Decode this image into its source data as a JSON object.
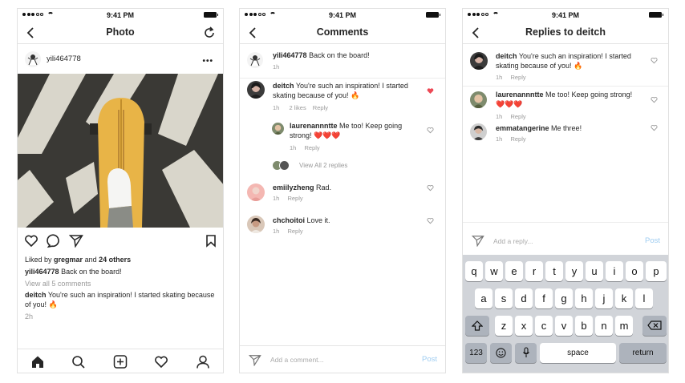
{
  "status": {
    "time": "9:41 PM"
  },
  "screen1": {
    "title": "Photo",
    "username": "yili464778",
    "liked_prefix": "Liked by",
    "liked_user": "gregmar",
    "liked_and": "and",
    "liked_count": "24 others",
    "caption_user": "yili464778",
    "caption_text": "Back on the board!",
    "view_all": "View all 5 comments",
    "comment_user": "deitch",
    "comment_text": "You're such an inspiration! I started skating because of you! 🔥",
    "time_ago": "2h",
    "tabs": [
      "home-icon",
      "search-icon",
      "add-icon",
      "heart-icon",
      "profile-icon"
    ]
  },
  "screen2": {
    "title": "Comments",
    "caption": {
      "user": "yili464778",
      "text": "Back on the board!",
      "time": "1h"
    },
    "comments": [
      {
        "user": "deitch",
        "text": "You're such an inspiration! I started skating because of you! 🔥",
        "time": "1h",
        "likes": "2 likes",
        "reply": "Reply"
      },
      {
        "user": "laurenannntte",
        "text": "Me too! Keep going strong! ❤️❤️❤️",
        "time": "1h",
        "reply": "Reply"
      },
      {
        "user": "emiilyzheng",
        "text": "Rad.",
        "time": "1h",
        "reply": "Reply"
      },
      {
        "user": "chchoitoi",
        "text": "Love it.",
        "time": "1h",
        "reply": "Reply"
      }
    ],
    "view_replies": "View All 2 replies",
    "input_placeholder": "Add a comment...",
    "post": "Post"
  },
  "screen3": {
    "title": "Replies to deitch",
    "replies": [
      {
        "user": "deitch",
        "text": "You're such an inspiration! I started skating because of you! 🔥",
        "time": "1h",
        "reply": "Reply"
      },
      {
        "user": "laurenannntte",
        "text": "Me too! Keep going strong! ❤️❤️❤️",
        "time": "1h",
        "reply": "Reply"
      },
      {
        "user": "emmatangerine",
        "text": "Me three!",
        "time": "1h",
        "reply": "Reply"
      }
    ],
    "input_placeholder": "Add a reply...",
    "post": "Post"
  },
  "keyboard": {
    "row1": [
      "q",
      "w",
      "e",
      "r",
      "t",
      "y",
      "u",
      "i",
      "o",
      "p"
    ],
    "row2": [
      "a",
      "s",
      "d",
      "f",
      "g",
      "h",
      "j",
      "k",
      "l"
    ],
    "row3": [
      "z",
      "x",
      "c",
      "v",
      "b",
      "n",
      "m"
    ],
    "numbers": "123",
    "space": "space",
    "return": "return"
  },
  "colors": {
    "like_red": "#ed4956",
    "post_blue": "#9fcdf1",
    "muted": "#999999"
  }
}
